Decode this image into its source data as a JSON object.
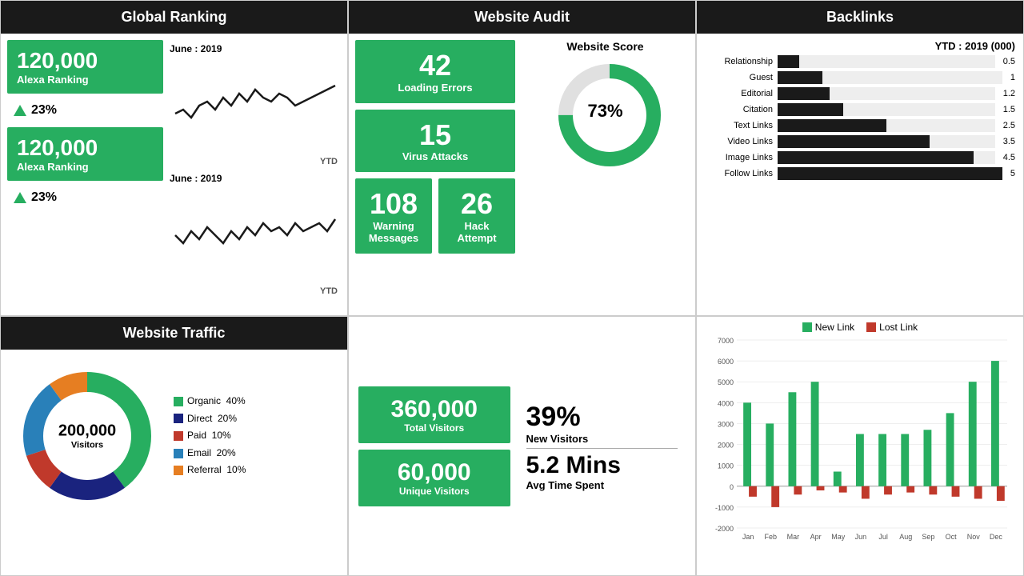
{
  "globalRanking": {
    "title": "Global Ranking",
    "stat1": {
      "number": "120,000",
      "label": "Alexa Ranking",
      "percent": "23%"
    },
    "stat2": {
      "number": "120,000",
      "label": "Alexa Ranking",
      "percent": "23%"
    },
    "chart1Label": "June : 2019",
    "chart1Ytd": "YTD",
    "chart2Label": "June : 2019",
    "chart2Ytd": "YTD"
  },
  "websiteAudit": {
    "title": "Website Audit",
    "loadingErrors": {
      "number": "42",
      "label": "Loading  Errors"
    },
    "virusAttacks": {
      "number": "15",
      "label": "Virus Attacks"
    },
    "warningMessages": {
      "number": "108",
      "label": "Warning  Messages"
    },
    "hackAttempt": {
      "number": "26",
      "label": "Hack Attempt"
    },
    "websiteScore": {
      "label": "Website Score",
      "percent": "73%",
      "value": 73
    }
  },
  "backlinks": {
    "title": "Backlinks",
    "ytd": "YTD : 2019 (000)",
    "maxValue": 5,
    "items": [
      {
        "label": "Relationship",
        "value": 0.5
      },
      {
        "label": "Guest",
        "value": 1
      },
      {
        "label": "Editorial",
        "value": 1.2
      },
      {
        "label": "Citation",
        "value": 1.5
      },
      {
        "label": "Text Links",
        "value": 2.5
      },
      {
        "label": "Video Links",
        "value": 3.5
      },
      {
        "label": "Image Links",
        "value": 4.5
      },
      {
        "label": "Follow Links",
        "value": 5
      }
    ]
  },
  "websiteTraffic": {
    "title": "Website Traffic",
    "centerNumber": "200,000",
    "centerLabel": "Visitors",
    "segments": [
      {
        "label": "Organic",
        "percent": "40%",
        "color": "#27ae60",
        "degrees": 144
      },
      {
        "label": "Direct",
        "percent": "20%",
        "color": "#1a237e",
        "degrees": 72
      },
      {
        "label": "Paid",
        "percent": "10%",
        "color": "#c0392b",
        "degrees": 36
      },
      {
        "label": "Email",
        "percent": "20%",
        "color": "#2980b9",
        "degrees": 72
      },
      {
        "label": "Referral",
        "percent": "10%",
        "color": "#e67e22",
        "degrees": 36
      }
    ]
  },
  "visitorsStats": {
    "totalVisitors": {
      "number": "360,000",
      "label": "Total Visitors"
    },
    "uniqueVisitors": {
      "number": "60,000",
      "label": "Unique Visitors"
    },
    "newVisitors": {
      "percent": "39%",
      "label": "New Visitors"
    },
    "avgTime": {
      "value": "5.2 Mins",
      "label": "Avg Time Spent"
    }
  },
  "linkChart": {
    "title": "",
    "legend": [
      {
        "label": "New Link",
        "color": "#27ae60"
      },
      {
        "label": "Lost Link",
        "color": "#c0392b"
      }
    ],
    "months": [
      "Jan",
      "Feb",
      "Mar",
      "Apr",
      "May",
      "Jun",
      "Jul",
      "Aug",
      "Sep",
      "Oct",
      "Nov",
      "Dec"
    ],
    "newLink": [
      4000,
      3000,
      4500,
      5000,
      700,
      2500,
      2500,
      2500,
      2700,
      3500,
      5000,
      6000
    ],
    "lostLink": [
      -500,
      -1000,
      -400,
      -200,
      -300,
      -600,
      -400,
      -300,
      -400,
      -500,
      -600,
      -700
    ],
    "yMax": 7000,
    "yMin": -2000,
    "yTicks": [
      7000,
      6000,
      5000,
      4000,
      3000,
      2000,
      1000,
      0,
      -1000,
      -2000
    ]
  }
}
